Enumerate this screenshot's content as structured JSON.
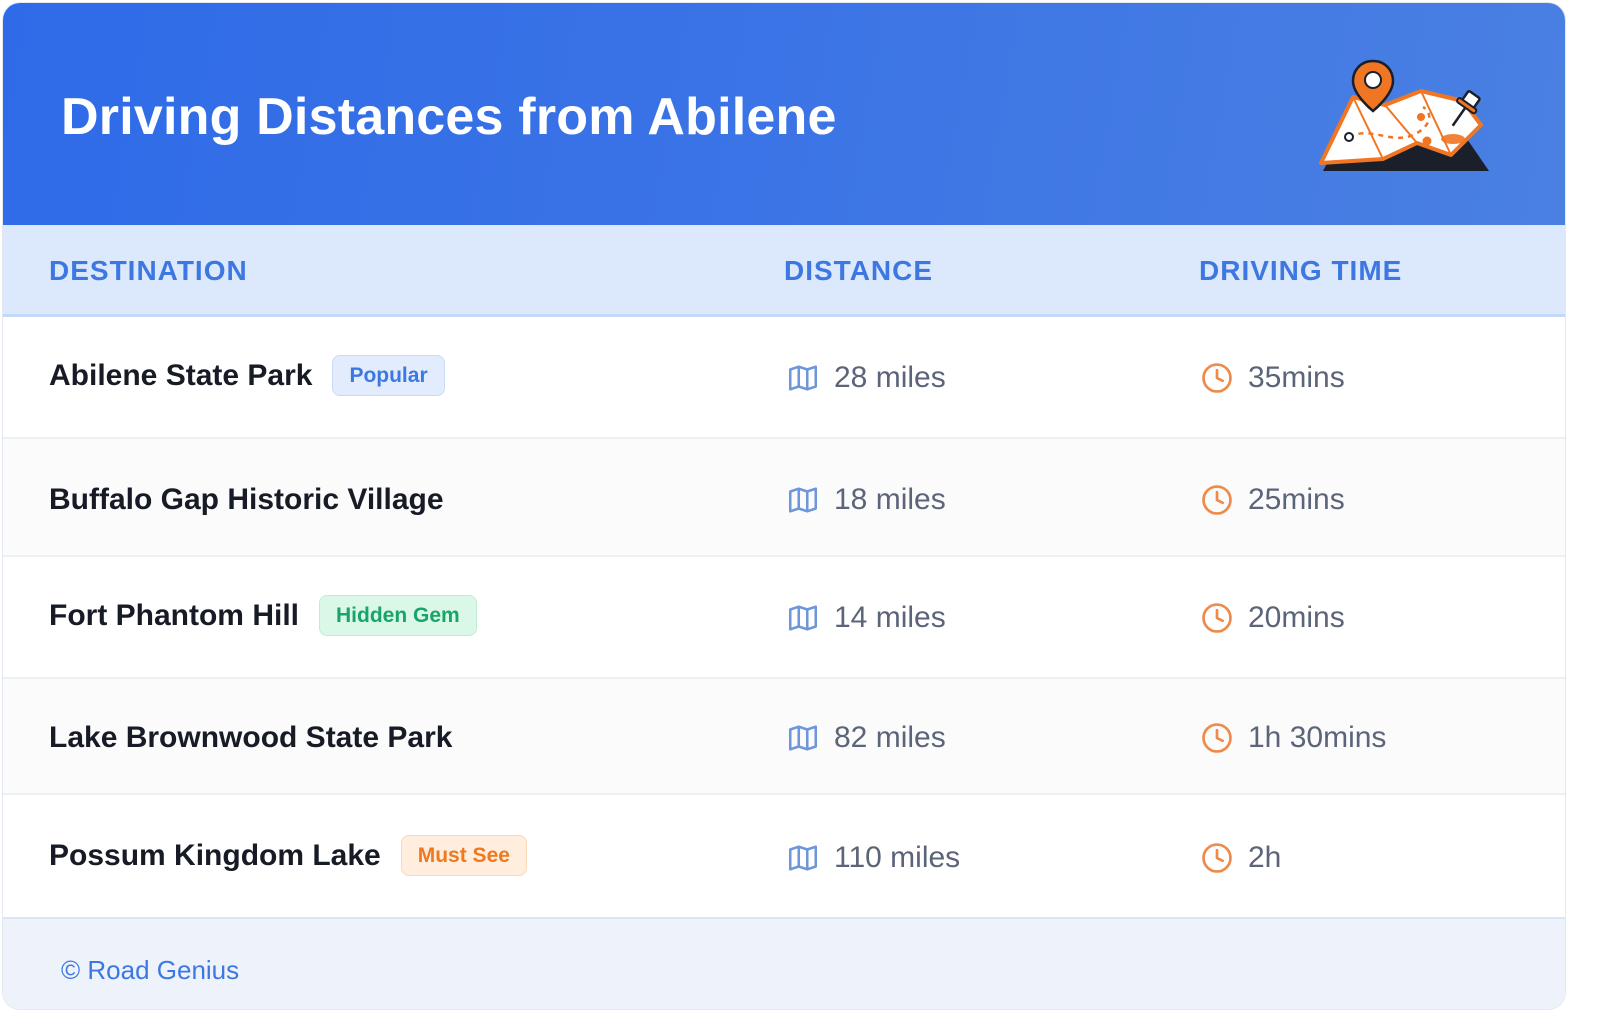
{
  "header": {
    "title": "Driving Distances from Abilene"
  },
  "table": {
    "columns": {
      "destination": "DESTINATION",
      "distance": "DISTANCE",
      "driving_time": "DRIVING TIME"
    },
    "rows": [
      {
        "destination": "Abilene State Park",
        "badge": "Popular",
        "badge_color": "blue",
        "distance": "28 miles",
        "time": "35mins"
      },
      {
        "destination": "Buffalo Gap Historic Village",
        "badge": "",
        "badge_color": "",
        "distance": "18 miles",
        "time": "25mins"
      },
      {
        "destination": "Fort Phantom Hill",
        "badge": "Hidden Gem",
        "badge_color": "green",
        "distance": "14 miles",
        "time": "20mins"
      },
      {
        "destination": "Lake Brownwood State Park",
        "badge": "",
        "badge_color": "",
        "distance": "82 miles",
        "time": "1h 30mins"
      },
      {
        "destination": "Possum Kingdom Lake",
        "badge": "Must See",
        "badge_color": "orange",
        "distance": "110 miles",
        "time": "2h"
      }
    ]
  },
  "footer": {
    "copyright": "© Road Genius"
  },
  "icons": {
    "distance": "map-icon",
    "time": "clock-icon",
    "header": "map-pin-illustration"
  },
  "colors": {
    "header": "#2f6be8",
    "accent": "#3d78e2",
    "clock": "#ef8a4a",
    "map_icon": "#6e96dc"
  }
}
